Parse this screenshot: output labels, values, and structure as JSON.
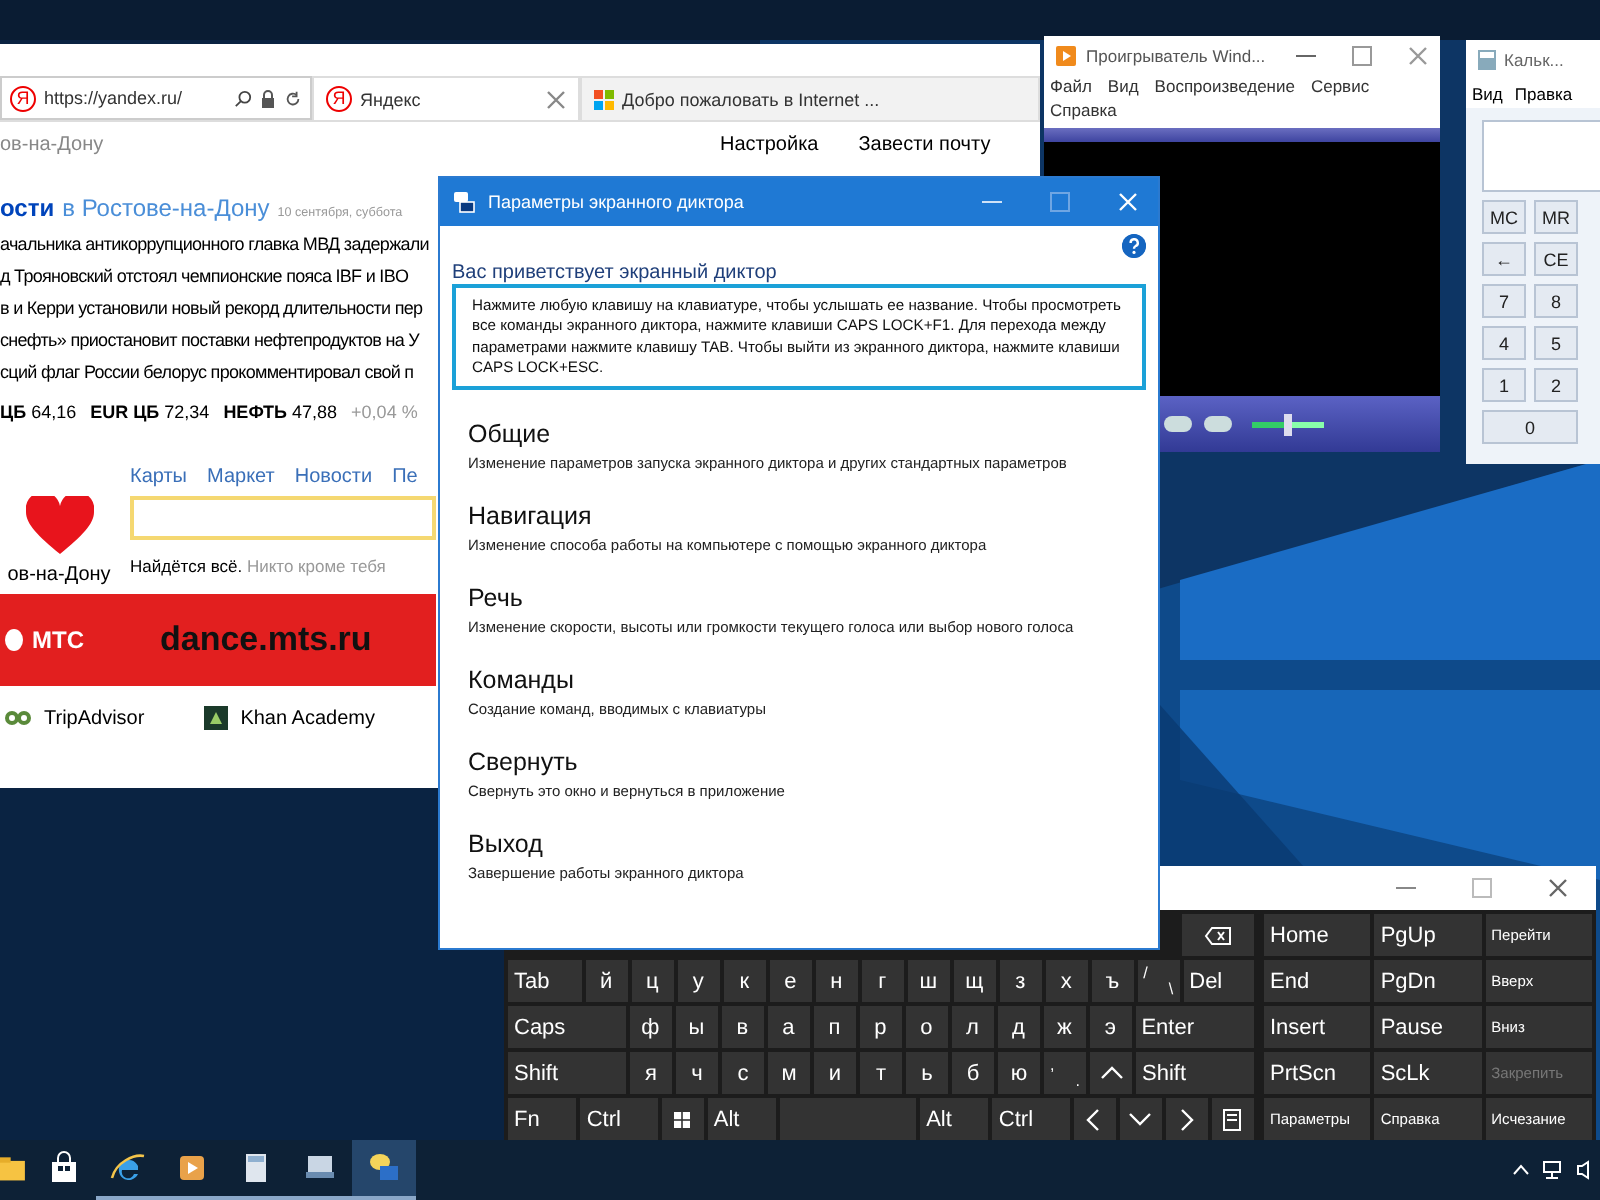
{
  "browser": {
    "address_icon": "Я",
    "address": "https://yandex.ru/",
    "tabs": [
      {
        "icon": "Я",
        "label": "Яндекс",
        "selected": true
      },
      {
        "label": "Добро пожаловать в Internet ...",
        "selected": false
      }
    ],
    "city": "ов-на-Дону",
    "header_links": [
      "Настройка",
      "Завести почту"
    ],
    "news": {
      "title": "ости",
      "region": "в Ростове-на-Дону",
      "date": "10 сентября, суббота",
      "items": [
        "ачальника антикоррупционного главка МВД задержали",
        "д Трояновский отстоял чемпионские пояса IBF и IBO",
        "в и Керри установили новый рекорд длительности пер",
        "снефть» приостановит поставки нефтепродуктов на У",
        "сций флаг России белорус прокомментировал свой п"
      ]
    },
    "rates": [
      {
        "label": "ЦБ",
        "value": "64,16"
      },
      {
        "label": "EUR ЦБ",
        "value": "72,34"
      },
      {
        "label": "НЕФТЬ",
        "value": "47,88"
      }
    ],
    "rate_change": "+0,04 %",
    "services": [
      "Карты",
      "Маркет",
      "Новости",
      "Пе"
    ],
    "logo_caption": "ов-на-Дону",
    "search": {
      "tagline": "Найдётся всё.",
      "slogan": "Никто кроме тебя"
    },
    "banner": {
      "brand": "МТС",
      "url": "dance.mts.ru"
    },
    "bookmarks": [
      "TripAdvisor",
      "Khan Academy"
    ]
  },
  "media_player": {
    "title": "Проигрыватель Wind...",
    "menu": [
      "Файл",
      "Вид",
      "Воспроизведение",
      "Сервис",
      "Справка"
    ],
    "volume": {
      "level": 0.45
    }
  },
  "calculator": {
    "title": "Кальк...",
    "menu": [
      "Вид",
      "Правка"
    ],
    "keys": [
      [
        "MC",
        "MR"
      ],
      [
        "←",
        "CE"
      ],
      [
        "7",
        "8"
      ],
      [
        "4",
        "5"
      ],
      [
        "1",
        "2"
      ],
      [
        "0"
      ]
    ]
  },
  "dialog": {
    "title": "Параметры экранного диктора",
    "welcome": "Вас приветствует экранный диктор",
    "intro": "Нажмите любую клавишу на клавиатуре, чтобы услышать ее название. Чтобы просмотреть все команды экранного диктора, нажмите клавиши CAPS LOCK+F1. Для перехода между параметрами нажмите клавишу TAB. Чтобы выйти из экранного диктора, нажмите клавиши CAPS LOCK+ESC.",
    "items": [
      {
        "title": "Общие",
        "description": "Изменение параметров запуска экранного диктора и других стандартных параметров"
      },
      {
        "title": "Навигация",
        "description": "Изменение способа работы на компьютере с помощью экранного диктора"
      },
      {
        "title": "Речь",
        "description": "Изменение скорости, высоты или громкости текущего голоса или выбор нового голоса"
      },
      {
        "title": "Команды",
        "description": "Создание команд, вводимых с клавиатуры"
      },
      {
        "title": "Свернуть",
        "description": "Свернуть это окно и вернуться в приложение"
      },
      {
        "title": "Выход",
        "description": "Завершение работы экранного диктора"
      }
    ]
  },
  "keyboard": {
    "main": [
      [
        {
          "kind": "backspace"
        }
      ],
      [
        {
          "kind": "label",
          "text": "Tab"
        },
        {
          "kind": "char",
          "text": "й"
        },
        {
          "kind": "char",
          "text": "ц"
        },
        {
          "kind": "char",
          "text": "у"
        },
        {
          "kind": "char",
          "text": "к"
        },
        {
          "kind": "char",
          "text": "е"
        },
        {
          "kind": "char",
          "text": "н"
        },
        {
          "kind": "char",
          "text": "г"
        },
        {
          "kind": "char",
          "text": "ш"
        },
        {
          "kind": "char",
          "text": "щ"
        },
        {
          "kind": "char",
          "text": "з"
        },
        {
          "kind": "char",
          "text": "х"
        },
        {
          "kind": "char",
          "text": "ъ"
        },
        {
          "kind": "pair",
          "top": "/",
          "bottom": "\\"
        },
        {
          "kind": "label",
          "text": "Del"
        }
      ],
      [
        {
          "kind": "label",
          "text": "Caps"
        },
        {
          "kind": "char",
          "text": "ф"
        },
        {
          "kind": "char",
          "text": "ы"
        },
        {
          "kind": "char",
          "text": "в"
        },
        {
          "kind": "char",
          "text": "а"
        },
        {
          "kind": "char",
          "text": "п"
        },
        {
          "kind": "char",
          "text": "р"
        },
        {
          "kind": "char",
          "text": "о"
        },
        {
          "kind": "char",
          "text": "л"
        },
        {
          "kind": "char",
          "text": "д"
        },
        {
          "kind": "char",
          "text": "ж"
        },
        {
          "kind": "char",
          "text": "э"
        },
        {
          "kind": "label",
          "text": "Enter"
        }
      ],
      [
        {
          "kind": "label",
          "text": "Shift"
        },
        {
          "kind": "char",
          "text": "я"
        },
        {
          "kind": "char",
          "text": "ч"
        },
        {
          "kind": "char",
          "text": "с"
        },
        {
          "kind": "char",
          "text": "м"
        },
        {
          "kind": "char",
          "text": "и"
        },
        {
          "kind": "char",
          "text": "т"
        },
        {
          "kind": "char",
          "text": "ь"
        },
        {
          "kind": "char",
          "text": "б"
        },
        {
          "kind": "char",
          "text": "ю"
        },
        {
          "kind": "pair",
          "top": ",",
          "bottom": "."
        },
        {
          "kind": "up"
        },
        {
          "kind": "label",
          "text": "Shift"
        }
      ],
      [
        {
          "kind": "label",
          "text": "Fn"
        },
        {
          "kind": "label",
          "text": "Ctrl"
        },
        {
          "kind": "windows"
        },
        {
          "kind": "label",
          "text": "Alt"
        },
        {
          "kind": "space"
        },
        {
          "kind": "label",
          "text": "Alt"
        },
        {
          "kind": "label",
          "text": "Ctrl"
        },
        {
          "kind": "left"
        },
        {
          "kind": "down"
        },
        {
          "kind": "right"
        },
        {
          "kind": "keyboard"
        }
      ]
    ],
    "nav": [
      [
        {
          "text": "Home",
          "disabled": false
        },
        {
          "text": "PgUp",
          "disabled": false
        },
        {
          "text": "Перейти",
          "disabled": false
        }
      ],
      [
        {
          "text": "End",
          "disabled": false
        },
        {
          "text": "PgDn",
          "disabled": false
        },
        {
          "text": "Вверх",
          "disabled": false
        }
      ],
      [
        {
          "text": "Insert",
          "disabled": false
        },
        {
          "text": "Pause",
          "disabled": false
        },
        {
          "text": "Вниз",
          "disabled": false
        }
      ],
      [
        {
          "text": "PrtScn",
          "disabled": false
        },
        {
          "text": "ScLk",
          "disabled": false
        },
        {
          "text": "Закрепить",
          "disabled": true
        }
      ],
      [
        {
          "text": "Параметры",
          "disabled": false
        },
        {
          "text": "Справка",
          "disabled": false
        },
        {
          "text": "Исчезание",
          "disabled": false
        }
      ]
    ]
  },
  "taskbar": {
    "apps": [
      {
        "kind": "folder",
        "selected": false,
        "running": false
      },
      {
        "kind": "store",
        "selected": false,
        "running": false
      },
      {
        "kind": "browser",
        "selected": false,
        "running": true
      },
      {
        "kind": "player",
        "selected": false,
        "running": true
      },
      {
        "kind": "calculator",
        "selected": false,
        "running": true
      },
      {
        "kind": "network",
        "selected": false,
        "running": true
      },
      {
        "kind": "narrator",
        "selected": true,
        "running": true
      }
    ]
  }
}
